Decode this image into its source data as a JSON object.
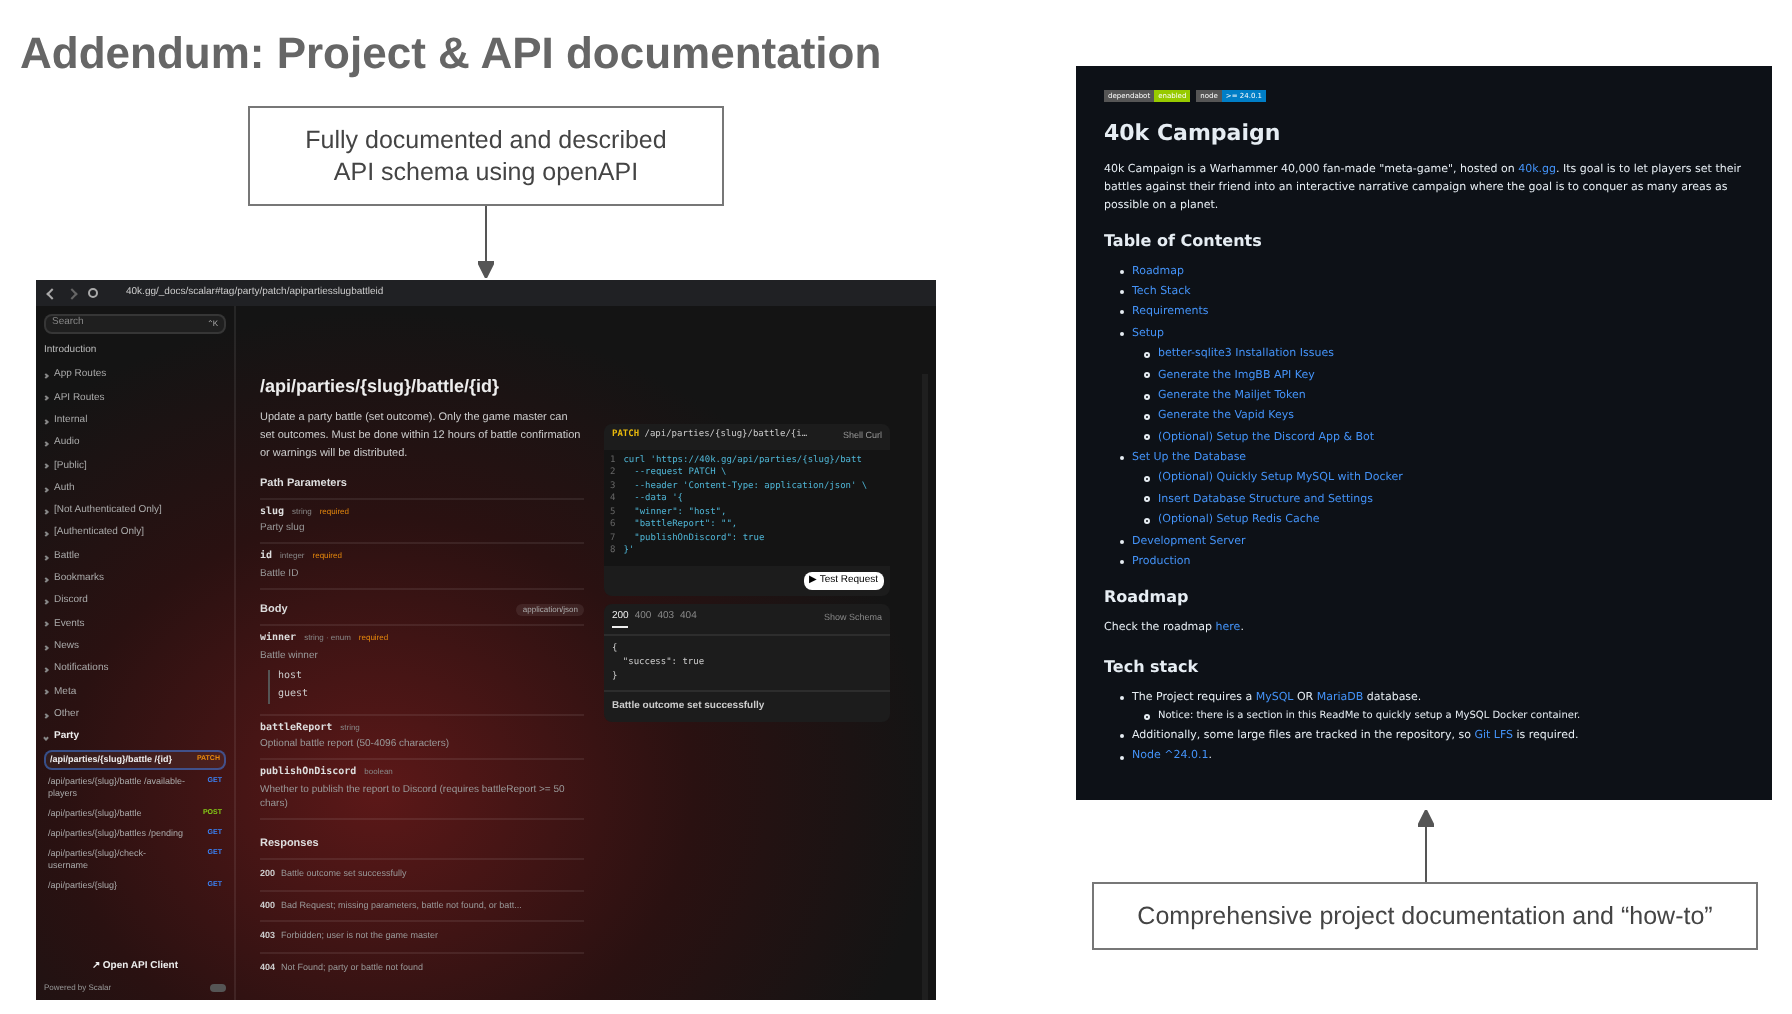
{
  "title": "Addendum: Project & API documentation",
  "callouts": [
    {
      "text": "Fully documented and described API schema using openAPI"
    },
    {
      "text": "Comprehensive project documentation and “how-to”"
    }
  ],
  "api_screenshot": {
    "address": "40k.gg/_docs/scalar#tag/party/patch/apipartiesslugbattleid",
    "search": {
      "placeholder": "Search",
      "shortcut": "⌃K"
    },
    "sidebar": {
      "heading": "Introduction",
      "groups": [
        {
          "label": "App Routes",
          "expanded": false
        },
        {
          "label": "API Routes",
          "expanded": false
        },
        {
          "label": "Internal",
          "expanded": false
        },
        {
          "label": "Audio",
          "expanded": false
        },
        {
          "label": "[Public]",
          "expanded": false
        },
        {
          "label": "Auth",
          "expanded": false
        },
        {
          "label": "[Not Authenticated Only]",
          "expanded": false
        },
        {
          "label": "[Authenticated Only]",
          "expanded": false
        },
        {
          "label": "Battle",
          "expanded": false
        },
        {
          "label": "Bookmarks",
          "expanded": false
        },
        {
          "label": "Discord",
          "expanded": false
        },
        {
          "label": "Events",
          "expanded": false
        },
        {
          "label": "News",
          "expanded": false
        },
        {
          "label": "Notifications",
          "expanded": false
        },
        {
          "label": "Meta",
          "expanded": false
        },
        {
          "label": "Other",
          "expanded": false
        },
        {
          "label": "Party",
          "expanded": true,
          "children": [
            {
              "path": "/api/parties/{slug}/battle /{id}",
              "method": "PATCH",
              "color": "#e8890c",
              "selected": true
            },
            {
              "path": "/api/parties/{slug}/battle /available-players",
              "method": "GET",
              "color": "#3b82f6",
              "selected": false
            },
            {
              "path": "/api/parties/{slug}/battle",
              "method": "POST",
              "color": "#84cc16",
              "selected": false
            },
            {
              "path": "/api/parties/{slug}/battles /pending",
              "method": "GET",
              "color": "#3b82f6",
              "selected": false
            },
            {
              "path": "/api/parties/{slug}/check- username",
              "method": "GET",
              "color": "#3b82f6",
              "selected": false
            },
            {
              "path": "/api/parties/{slug}",
              "method": "GET",
              "color": "#3b82f6",
              "selected": false
            }
          ]
        }
      ]
    },
    "client_button": "↗ Open API Client",
    "powered_by": "Powered by Scalar",
    "main": {
      "heading": "/api/parties/{slug}/battle/{id}",
      "description": "Update a party battle (set outcome). Only the game master can set outcomes. Must be done within 12 hours of battle confirmation or warnings will be distributed.",
      "path_parameters": {
        "title": "Path Parameters",
        "fields": [
          {
            "name": "slug",
            "type": "string",
            "required": "required",
            "description": "Party slug"
          },
          {
            "name": "id",
            "type": "integer",
            "required": "required",
            "description": "Battle ID"
          }
        ]
      },
      "body": {
        "title": "Body",
        "content_type": "application/json",
        "fields": [
          {
            "name": "winner",
            "type": "string · enum",
            "required": "required",
            "description": "Battle winner",
            "enum": [
              "host",
              "guest"
            ]
          },
          {
            "name": "battleReport",
            "type": "string",
            "description": "Optional battle report (50-4096 characters)"
          },
          {
            "name": "publishOnDiscord",
            "type": "boolean",
            "description": "Whether to publish the report to Discord (requires battleReport >= 50 chars)"
          }
        ]
      },
      "responses": {
        "title": "Responses",
        "items": [
          {
            "code": "200",
            "text": "Battle outcome set successfully"
          },
          {
            "code": "400",
            "text": "Bad Request; missing parameters, battle not found, or batt..."
          },
          {
            "code": "403",
            "text": "Forbidden; user is not the game master"
          },
          {
            "code": "404",
            "text": "Not Found; party or battle not found"
          }
        ]
      }
    },
    "request": {
      "method": "PATCH",
      "path": "/api/parties/{slug}/battle/{i…",
      "client": "Shell Curl",
      "lines": [
        {
          "n": "1",
          "text": "curl 'https://40k.gg/api/parties/{slug}/batt"
        },
        {
          "n": "2",
          "text": "  --request PATCH \\"
        },
        {
          "n": "3",
          "text": "  --header 'Content-Type: application/json' \\"
        },
        {
          "n": "4",
          "text": "  --data '{"
        },
        {
          "n": "5",
          "text": "  \"winner\": \"host\","
        },
        {
          "n": "6",
          "text": "  \"battleReport\": \"\","
        },
        {
          "n": "7",
          "text": "  \"publishOnDiscord\": true"
        },
        {
          "n": "8",
          "text": "}'"
        }
      ],
      "test_button": "▶ Test Request"
    },
    "response": {
      "tabs": [
        {
          "label": "200",
          "selected": true
        },
        {
          "label": "400",
          "selected": false
        },
        {
          "label": "403",
          "selected": false
        },
        {
          "label": "404",
          "selected": false
        }
      ],
      "show_schema": "Show Schema",
      "lines": [
        "{",
        "  \"success\": true",
        "}"
      ],
      "caption": "Battle outcome set successfully"
    }
  },
  "readme_screenshot": {
    "badges": [
      {
        "label": "dependabot",
        "value": "enabled",
        "color": "#97ca00"
      },
      {
        "label": "node",
        "value": ">= 24.0.1",
        "color": "#007ec6"
      }
    ],
    "title": "40k Campaign",
    "intro": [
      {
        "text": "40k Campaign is a Warhammer 40,000 fan-made \"meta-game\", hosted on ",
        "link": false
      },
      {
        "text": "40k.gg",
        "link": true
      },
      {
        "text": ". Its goal is to let players set their battles against their friend into an interactive narrative campaign where the goal is to conquer as many areas as possible on a planet.",
        "link": false
      }
    ],
    "toc_title": "Table of Contents",
    "toc": [
      {
        "text": "Roadmap"
      },
      {
        "text": "Tech Stack"
      },
      {
        "text": "Requirements"
      },
      {
        "text": "Setup",
        "children": [
          {
            "text": "better-sqlite3 Installation Issues"
          },
          {
            "text": "Generate the ImgBB API Key"
          },
          {
            "text": "Generate the Mailjet Token"
          },
          {
            "text": "Generate the Vapid Keys"
          },
          {
            "text": "(Optional) Setup the Discord App & Bot"
          }
        ]
      },
      {
        "text": "Set Up the Database",
        "children": [
          {
            "text": "(Optional) Quickly Setup MySQL with Docker"
          },
          {
            "text": "Insert Database Structure and Settings"
          },
          {
            "text": "(Optional) Setup Redis Cache"
          }
        ]
      },
      {
        "text": "Development Server"
      },
      {
        "text": "Production"
      }
    ],
    "roadmap_title": "Roadmap",
    "roadmap_text": [
      {
        "text": "Check the roadmap ",
        "link": false
      },
      {
        "text": "here",
        "link": true
      },
      {
        "text": ".",
        "link": false
      }
    ],
    "tech_title": "Tech stack",
    "tech": [
      {
        "parts": [
          {
            "text": "The Project requires a ",
            "link": false
          },
          {
            "text": "MySQL",
            "link": true
          },
          {
            "text": " OR ",
            "link": false
          },
          {
            "text": "MariaDB",
            "link": true
          },
          {
            "text": " database.",
            "link": false
          }
        ],
        "children": [
          {
            "parts": [
              {
                "text": "Notice: there is a section in this ReadMe to quickly setup a MySQL Docker container.",
                "link": false
              }
            ]
          }
        ]
      },
      {
        "parts": [
          {
            "text": "Additionally, some large files are tracked in the repository, so ",
            "link": false
          },
          {
            "text": "Git LFS",
            "link": true
          },
          {
            "text": " is required.",
            "link": false
          }
        ]
      },
      {
        "parts": [
          {
            "text": "Node ^24.0.1",
            "link": true
          },
          {
            "text": ".",
            "link": false
          }
        ]
      }
    ]
  }
}
